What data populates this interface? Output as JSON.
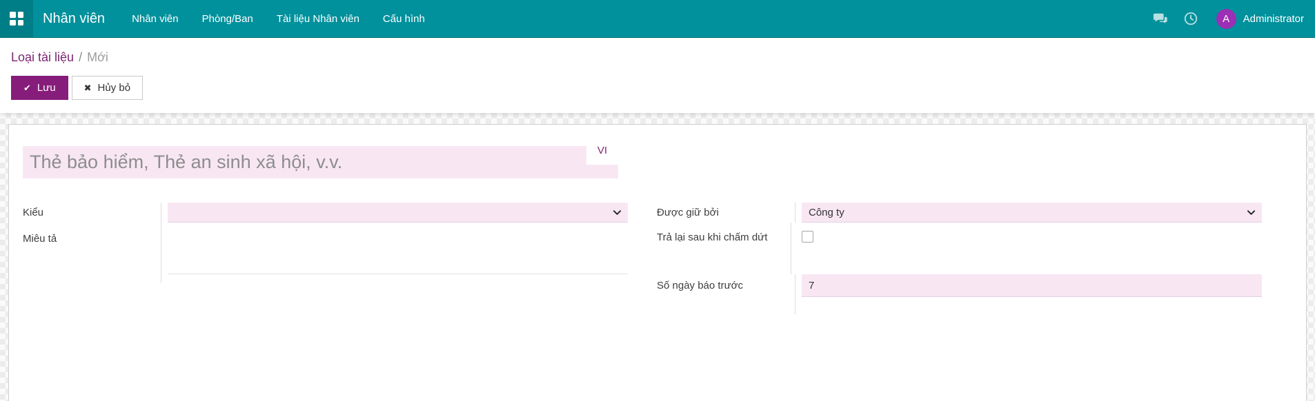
{
  "colors": {
    "navbar_teal": "#00919c",
    "primary_purple": "#871d7b",
    "link_purple": "#7c2472",
    "avatar_purple": "#9b2fb5",
    "field_highlight_pink": "#f8e7f3"
  },
  "navbar": {
    "app_title": "Nhân viên",
    "menu_items": [
      {
        "label": "Nhân viên"
      },
      {
        "label": "Phòng/Ban"
      },
      {
        "label": "Tài liệu Nhân viên"
      },
      {
        "label": "Cấu hình"
      }
    ],
    "icons": {
      "apps_grid": "apps-grid-icon",
      "chat": "chat-bubbles-icon",
      "activity": "clock-icon"
    },
    "user": {
      "name": "Administrator",
      "avatar_initial": "A"
    }
  },
  "breadcrumb": {
    "parent": "Loại tài liệu",
    "separator": "/",
    "current": "Mới"
  },
  "actions": {
    "save_label": "Lưu",
    "save_icon_glyph": "✔",
    "discard_label": "Hủy bỏ",
    "discard_icon_glyph": "✖"
  },
  "form": {
    "name_field": {
      "placeholder": "Thẻ bảo hiểm, Thẻ an sinh xã hội, v.v.",
      "value": "",
      "translation_badge": "VI"
    },
    "left_group": {
      "type": {
        "label": "Kiểu",
        "value": ""
      },
      "description": {
        "label": "Miêu tả",
        "value": ""
      }
    },
    "right_group": {
      "held_by": {
        "label": "Được giữ bởi",
        "value": "Công ty"
      },
      "return_on_termination": {
        "label": "Trả lại sau khi chấm dứt",
        "checked": false
      },
      "notice_days": {
        "label": "Số ngày báo trước",
        "value": "7"
      }
    }
  }
}
